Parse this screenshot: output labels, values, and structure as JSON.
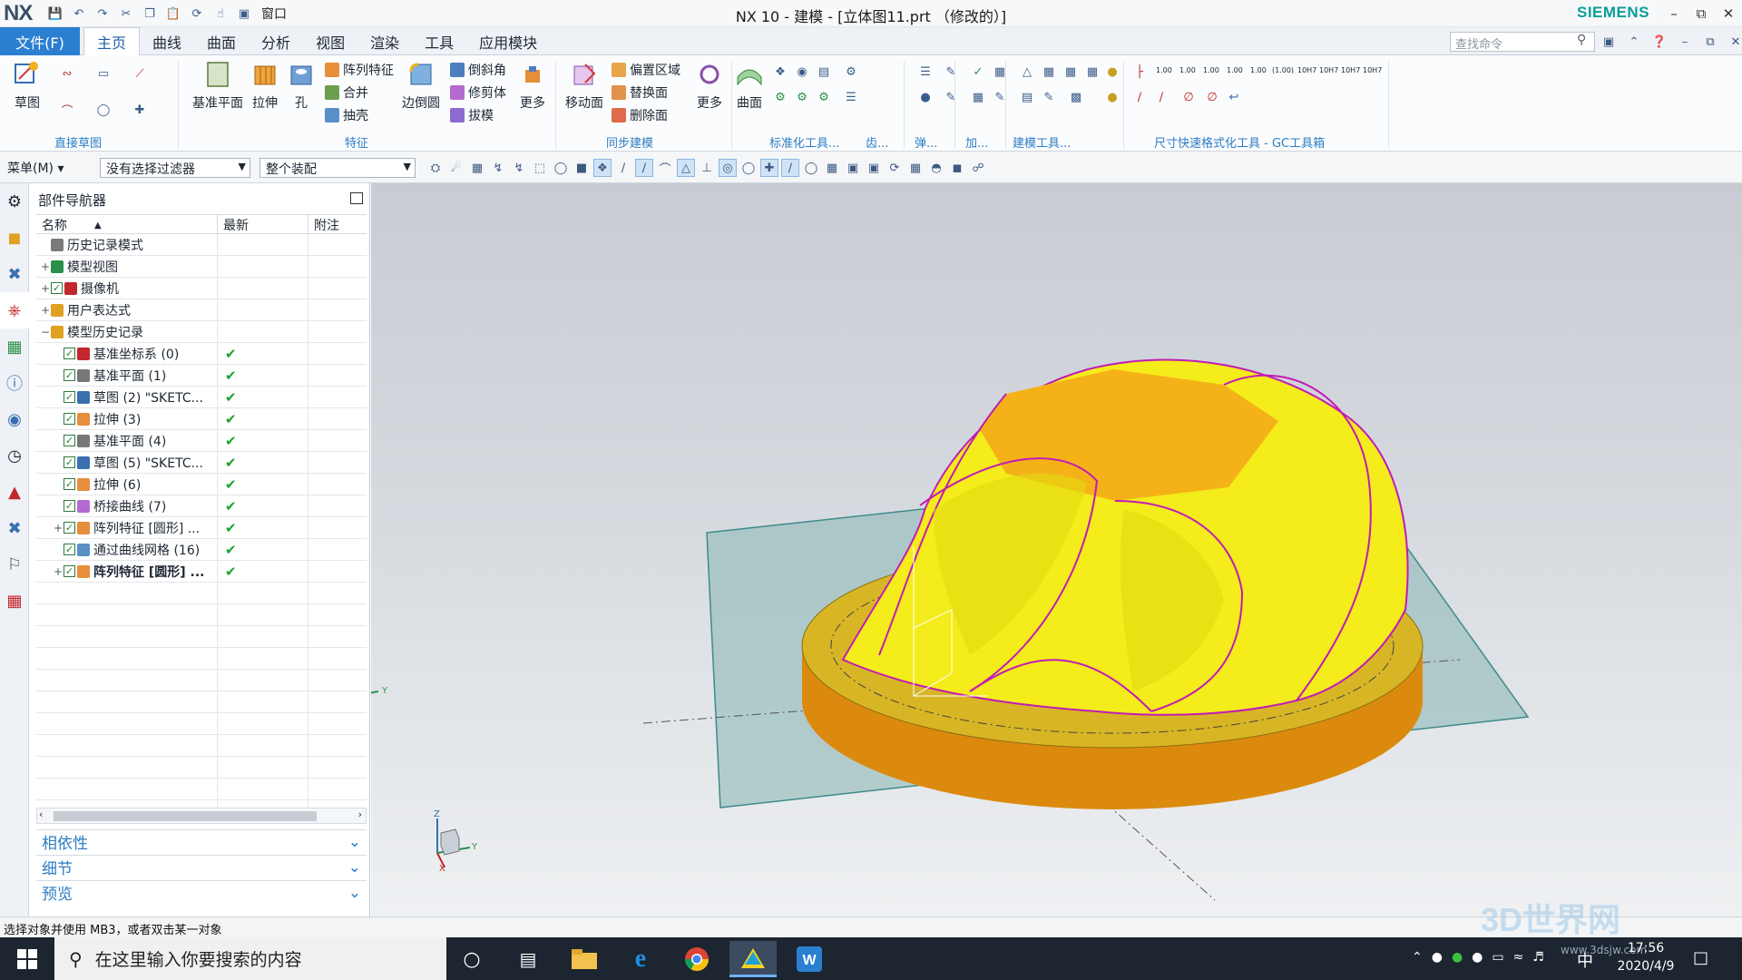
{
  "title_bar": {
    "logo": "NX",
    "quick_access": [
      "save-icon",
      "undo-icon",
      "redo-icon",
      "cut-icon",
      "copy-icon",
      "paste-icon",
      "repeat-icon",
      "touch-icon",
      "window-icon"
    ],
    "window_menu": "窗口",
    "title": "NX 10 - 建模 - [立体图11.prt （修改的）]",
    "brand": "SIEMENS",
    "controls": [
      "minimize",
      "restore",
      "close"
    ]
  },
  "ribbon_tabs": {
    "file": "文件(F)",
    "tabs": [
      "主页",
      "曲线",
      "曲面",
      "分析",
      "视图",
      "渲染",
      "工具",
      "应用模块"
    ],
    "active": "主页",
    "search_placeholder": "查找命令"
  },
  "ribbon": {
    "groups": [
      {
        "label": "直接草图",
        "buttons": [
          "草图"
        ]
      },
      {
        "label": "特征",
        "buttons": [
          "基准平面",
          "拉伸",
          "孔",
          "阵列特征",
          "合并",
          "抽壳",
          "边倒圆",
          "倒斜角",
          "修剪体",
          "拔模",
          "更多"
        ]
      },
      {
        "label": "同步建模",
        "buttons": [
          "移动面",
          "偏置区域",
          "替换面",
          "删除面",
          "更多"
        ]
      },
      {
        "label": "标准化工具...",
        "buttons": [
          "曲面"
        ]
      },
      {
        "label": "齿..."
      },
      {
        "label": "弹..."
      },
      {
        "label": "加..."
      },
      {
        "label": "建模工具..."
      },
      {
        "label": "尺寸快速格式化工具 - GC工具箱"
      }
    ],
    "dim_labels": [
      "1.00",
      "1.00",
      "1.00",
      "1.00",
      "1.00",
      "(1.00)",
      "10H7",
      "10H7",
      "10H7",
      "10H7"
    ]
  },
  "selection_bar": {
    "menu": "菜单(M)",
    "filter": "没有选择过滤器",
    "scope": "整个装配"
  },
  "navigator": {
    "title": "部件导航器",
    "columns": [
      "名称",
      "最新",
      "附注"
    ],
    "rows": [
      {
        "label": "历史记录模式",
        "indent": 0,
        "expand": "",
        "check": false,
        "latest": ""
      },
      {
        "label": "模型视图",
        "indent": 0,
        "expand": "+",
        "check": false,
        "latest": ""
      },
      {
        "label": "摄像机",
        "indent": 0,
        "expand": "+",
        "check": true,
        "latest": ""
      },
      {
        "label": "用户表达式",
        "indent": 0,
        "expand": "+",
        "check": false,
        "latest": ""
      },
      {
        "label": "模型历史记录",
        "indent": 0,
        "expand": "−",
        "check": false,
        "latest": ""
      },
      {
        "label": "基准坐标系 (0)",
        "indent": 1,
        "expand": "",
        "check": true,
        "latest": "✔"
      },
      {
        "label": "基准平面 (1)",
        "indent": 1,
        "expand": "",
        "check": true,
        "latest": "✔"
      },
      {
        "label": "草图 (2) \"SKETC...",
        "indent": 1,
        "expand": "",
        "check": true,
        "latest": "✔"
      },
      {
        "label": "拉伸 (3)",
        "indent": 1,
        "expand": "",
        "check": true,
        "latest": "✔"
      },
      {
        "label": "基准平面 (4)",
        "indent": 1,
        "expand": "",
        "check": true,
        "latest": "✔"
      },
      {
        "label": "草图 (5) \"SKETC...",
        "indent": 1,
        "expand": "",
        "check": true,
        "latest": "✔"
      },
      {
        "label": "拉伸 (6)",
        "indent": 1,
        "expand": "",
        "check": true,
        "latest": "✔"
      },
      {
        "label": "桥接曲线 (7)",
        "indent": 1,
        "expand": "",
        "check": true,
        "latest": "✔"
      },
      {
        "label": "阵列特征 [圆形] ...",
        "indent": 1,
        "expand": "+",
        "check": true,
        "latest": "✔"
      },
      {
        "label": "通过曲线网格 (16)",
        "indent": 1,
        "expand": "",
        "check": true,
        "latest": "✔"
      },
      {
        "label": "阵列特征 [圆形] ...",
        "indent": 1,
        "expand": "+",
        "check": true,
        "latest": "✔",
        "bold": true
      }
    ],
    "sections": [
      "相依性",
      "细节",
      "预览"
    ]
  },
  "viewport": {
    "triad": {
      "x": "X",
      "y": "Y",
      "z": "Z"
    }
  },
  "status": "选择对象并使用 MB3，或者双击某一对象",
  "taskbar": {
    "search": "在这里输入你要搜索的内容",
    "ime": "中",
    "time": "17:56",
    "date": "2020/4/9"
  },
  "watermark": {
    "brand": "3D世界网",
    "url": "www.3dsjw.com"
  },
  "colors": {
    "accent": "#2b7fd1",
    "part_yellow": "#f4ec1b",
    "part_orange": "#e58a0a",
    "plane": "#8fb9b8",
    "edge": "#c21bb5"
  }
}
